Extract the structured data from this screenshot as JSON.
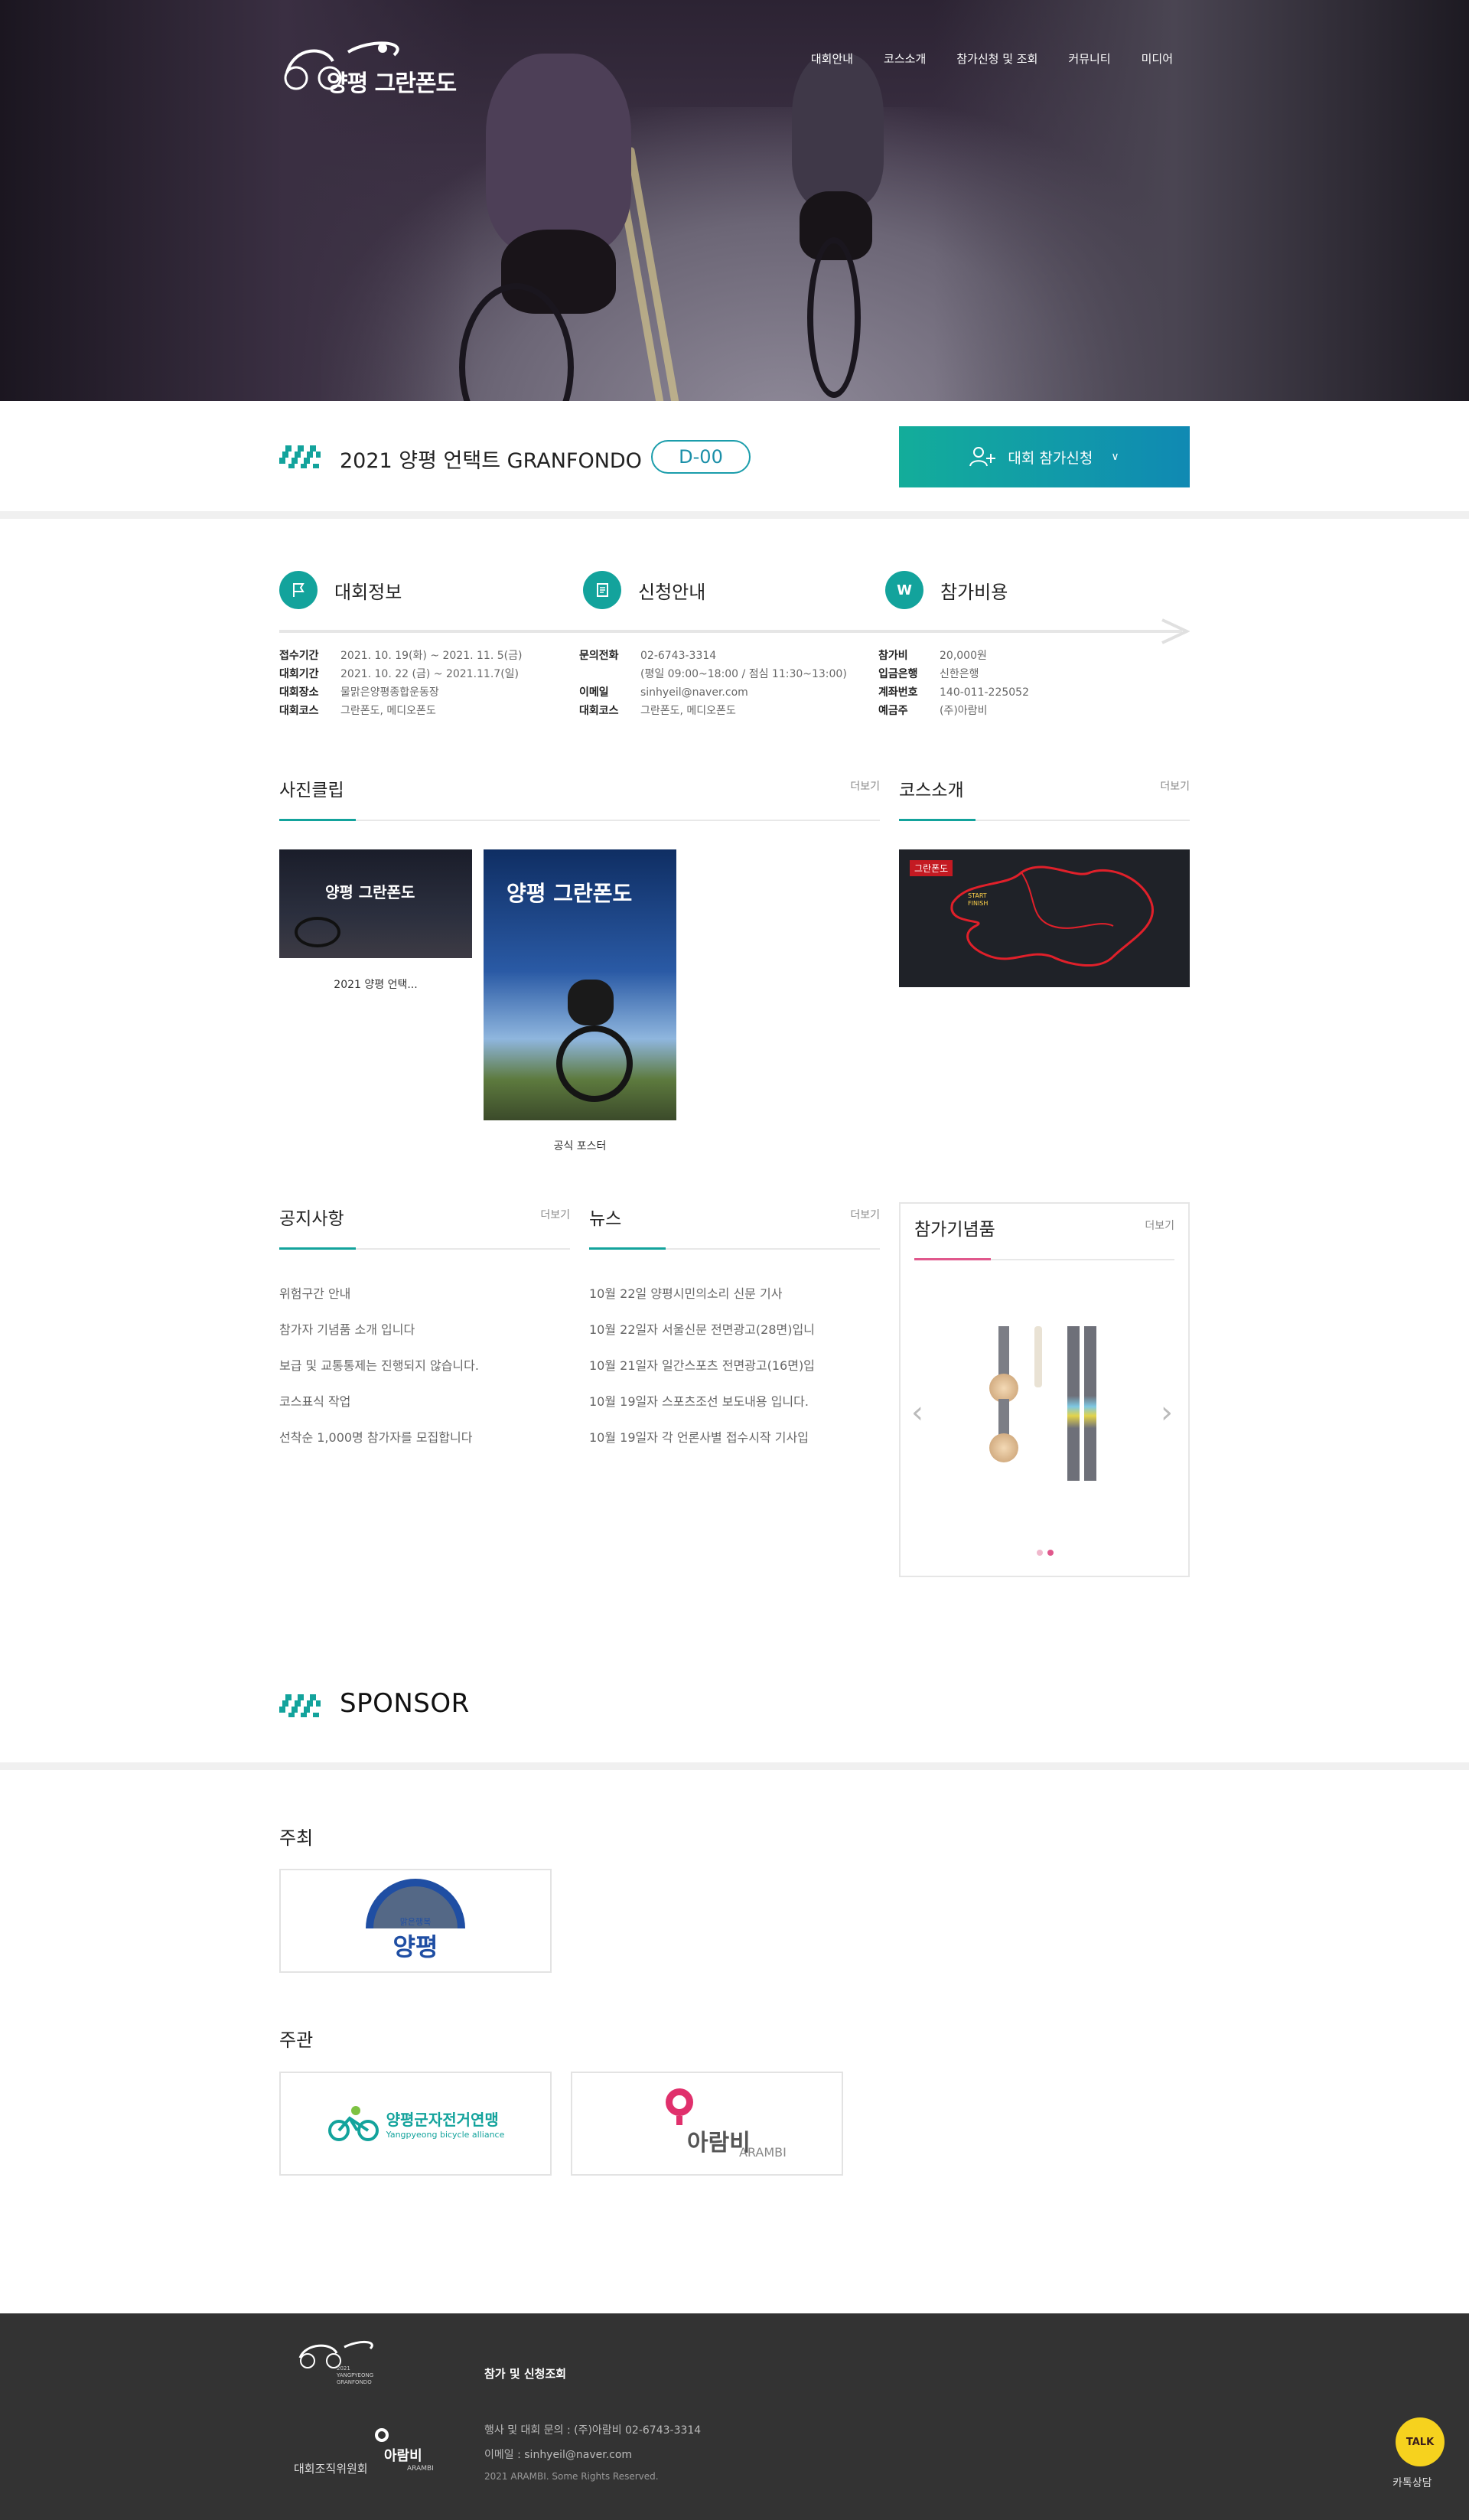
{
  "header": {
    "logo_text": "양평 그란폰도",
    "nav": [
      "대회안내",
      "코스소개",
      "참가신청 및 조회",
      "커뮤니티",
      "미디어"
    ]
  },
  "titlebar": {
    "event_title": "2021 양평 언택트 GRANFONDO",
    "dday": "D-00",
    "apply_label": "대회 참가신청"
  },
  "info": {
    "competition": {
      "title": "대회정보",
      "rows": [
        {
          "k": "접수기간",
          "v": "2021. 10. 19(화) ~ 2021. 11. 5(금)"
        },
        {
          "k": "대회기간",
          "v": "2021. 10. 22 (금) ~ 2021.11.7(일)"
        },
        {
          "k": "대회장소",
          "v": "물맑은양평종합운동장"
        },
        {
          "k": "대회코스",
          "v": "그란폰도, 메디오폰도"
        }
      ]
    },
    "application": {
      "title": "신청안내",
      "rows": [
        {
          "k": "문의전화",
          "v": "02-6743-3314"
        },
        {
          "k": "",
          "v": "(평일 09:00~18:00 / 점심 11:30~13:00)"
        },
        {
          "k": "이메일",
          "v": "sinhyeil@naver.com"
        },
        {
          "k": "대회코스",
          "v": "그란폰도, 메디오폰도"
        }
      ]
    },
    "fee": {
      "title": "참가비용",
      "rows": [
        {
          "k": "참가비",
          "v": "20,000원"
        },
        {
          "k": "입금은행",
          "v": "신한은행"
        },
        {
          "k": "계좌번호",
          "v": "140-011-225052"
        },
        {
          "k": "예금주",
          "v": "(주)아람비"
        }
      ]
    }
  },
  "photo_clip": {
    "title": "사진클립",
    "more": "더보기",
    "items": [
      {
        "caption": "2021 양평 언택..."
      },
      {
        "caption": "공식 포스터"
      }
    ]
  },
  "course": {
    "title": "코스소개",
    "more": "더보기",
    "map_label": "그란폰도",
    "map_tags": [
      "START",
      "FINISH"
    ]
  },
  "notice": {
    "title": "공지사항",
    "more": "더보기",
    "items": [
      "위험구간 안내",
      "참가자 기념품 소개 입니다",
      "보급 및 교통통제는 진행되지 않습니다.",
      "코스표식 작업",
      "선착순 1,000명 참가자를 모집합니다"
    ]
  },
  "news": {
    "title": "뉴스",
    "more": "더보기",
    "items": [
      "10월 22일 양평시민의소리 신문 기사",
      "10월 22일자 서울신문 전면광고(28면)입니",
      "10월 21일자 일간스포츠 전면광고(16면)입",
      "10월 19일자 스포츠조선 보도내용 입니다.",
      "10월 19일자 각 언론사별 접수시작 기사입"
    ]
  },
  "souvenir": {
    "title": "참가기념품",
    "more": "더보기",
    "slide_count": 2,
    "active_slide": 2
  },
  "sponsor": {
    "title": "SPONSOR",
    "host_label": "주최",
    "host_logo": {
      "small": "맑은행복",
      "big": "양평"
    },
    "organizer_label": "주관",
    "organizer_logos": [
      {
        "name": "양평군자전거연맹",
        "sub": "Yangpyeong bicycle alliance"
      },
      {
        "name": "ARAMBI",
        "glyph": "아람비"
      }
    ]
  },
  "footer": {
    "logo_lines": [
      "2021",
      "YANGPYEONG",
      "GRANFONDO"
    ],
    "committee": "대회조직위원회",
    "committee_brand": "ARAMBI",
    "link": "참가 및 신청조회",
    "contact": "행사 및 대회 문의 : (주)아람비 02-6743-3314",
    "email": "이메일 : sinhyeil@naver.com",
    "copyright": "2021 ARAMBI. Some Rights Reserved.",
    "kakao_badge": "TALK",
    "kakao_label": "카톡상담"
  },
  "colors": {
    "accent": "#13a39c",
    "accent_blue": "#1089b3",
    "pink": "#e0588c",
    "footer_bg": "#333333"
  }
}
